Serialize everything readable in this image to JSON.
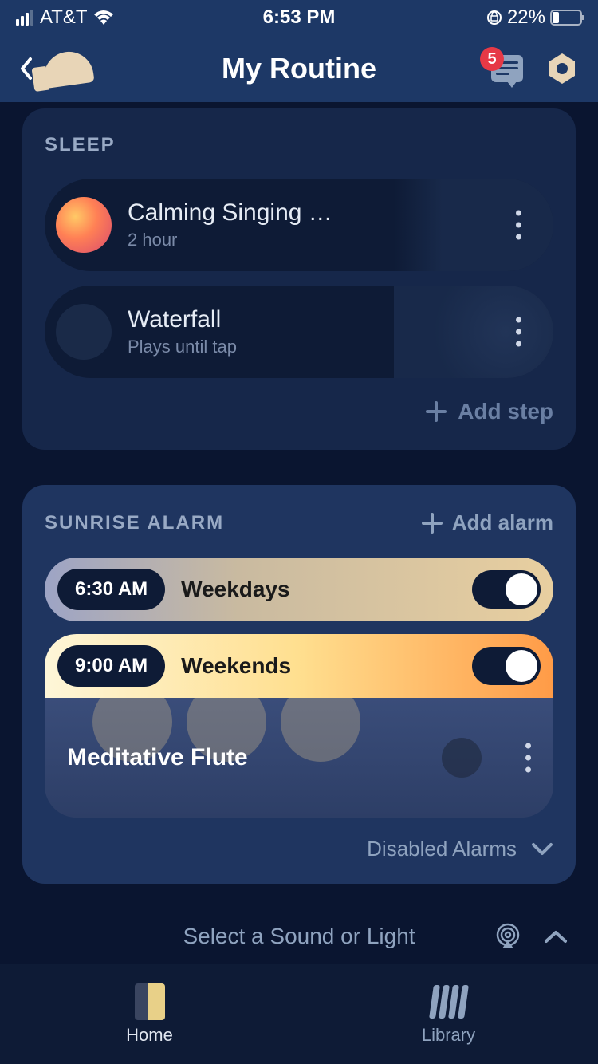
{
  "status": {
    "carrier": "AT&T",
    "time": "6:53 PM",
    "battery_pct": "22%"
  },
  "nav": {
    "title": "My Routine",
    "badge_count": "5"
  },
  "sleep": {
    "header": "SLEEP",
    "items": [
      {
        "name": "Calming Singing B...",
        "sub": "2 hour"
      },
      {
        "name": "Waterfall",
        "sub": "Plays until tap"
      }
    ],
    "add_step": "Add step"
  },
  "alarm": {
    "header": "SUNRISE ALARM",
    "add_alarm": "Add alarm",
    "alarms": [
      {
        "time": "6:30 AM",
        "label": "Weekdays",
        "enabled": true
      },
      {
        "time": "9:00 AM",
        "label": "Weekends",
        "enabled": true
      }
    ],
    "sound": "Meditative Flute",
    "disabled_label": "Disabled Alarms"
  },
  "player": {
    "prompt": "Select a Sound or Light"
  },
  "tabs": {
    "home": "Home",
    "library": "Library"
  }
}
